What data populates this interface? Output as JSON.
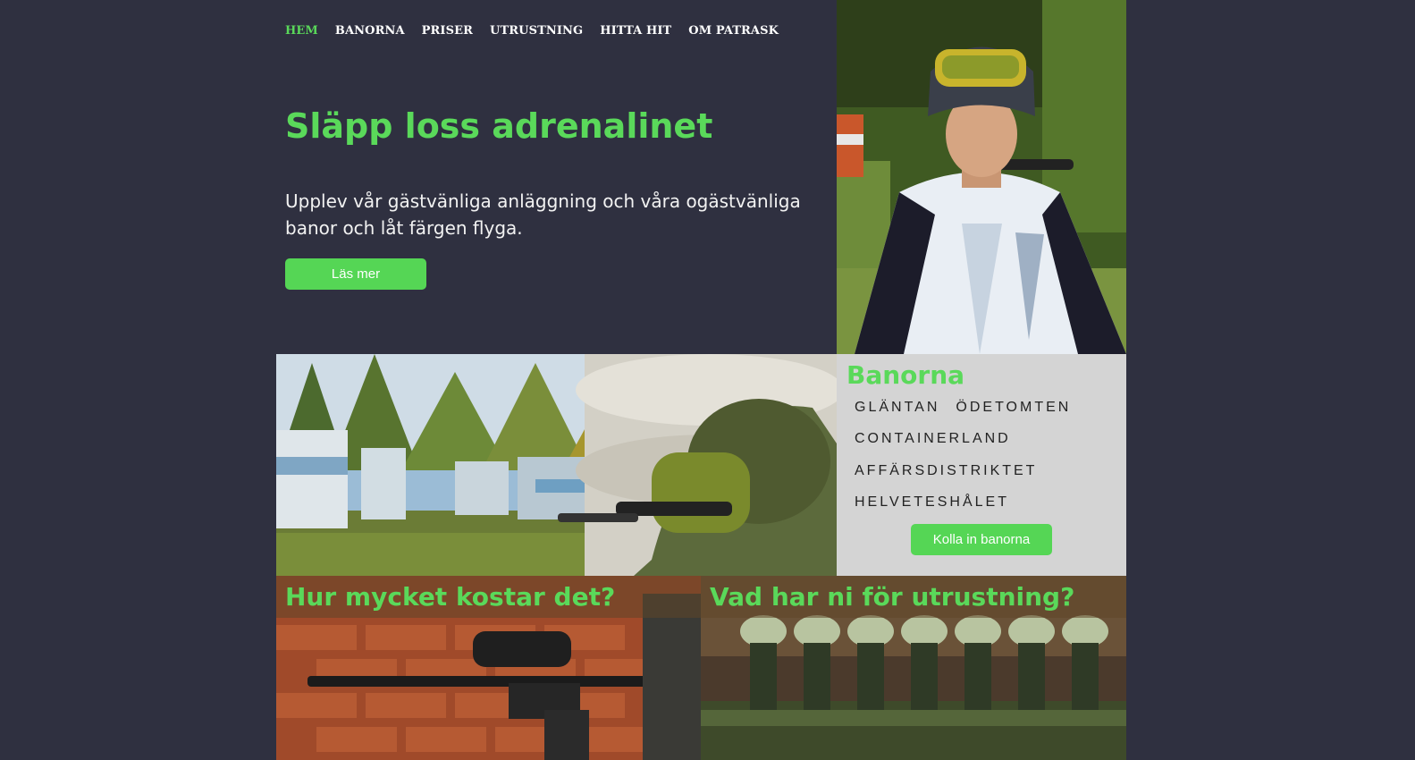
{
  "nav": {
    "items": [
      {
        "label": "HEM",
        "active": true
      },
      {
        "label": "BANORNA",
        "active": false
      },
      {
        "label": "PRISER",
        "active": false
      },
      {
        "label": "UTRUSTNING",
        "active": false
      },
      {
        "label": "HITTA HIT",
        "active": false
      },
      {
        "label": "OM PATRASK",
        "active": false
      }
    ]
  },
  "hero": {
    "title": "Släpp loss adrenalinet",
    "text": "Upplev vår gästvänliga anläggning och våra ogästvänliga banor och låt färgen flyga.",
    "button_label": "Läs mer"
  },
  "banorna": {
    "title": "Banorna",
    "tracks": [
      [
        "GLÄNTAN",
        "ÖDETOMTEN"
      ],
      [
        "CONTAINERLAND"
      ],
      [
        "AFFÄRSDISTRIKTET"
      ],
      [
        "HELVETESHÅLET"
      ]
    ],
    "button_label": "Kolla in banorna"
  },
  "price_section": {
    "title": "Hur mycket kostar det?"
  },
  "gear_section": {
    "title": "Vad har ni för utrustning?"
  },
  "colors": {
    "background": "#2f3040",
    "accent": "#5ad95a",
    "panel": "#d4d4d4"
  }
}
